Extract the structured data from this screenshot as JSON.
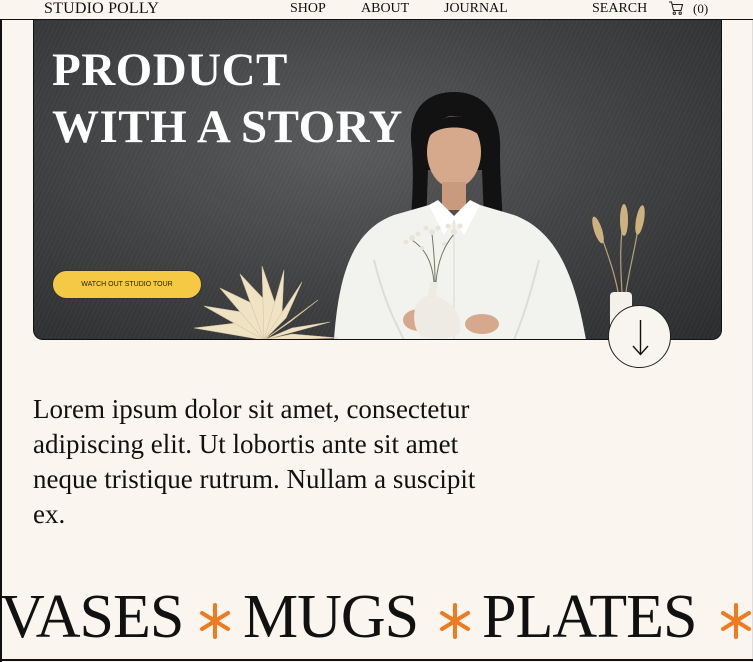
{
  "nav": {
    "logo": "STUDIO POLLY",
    "links": [
      "SHOP",
      "ABOUT",
      "JOURNAL"
    ],
    "search": "SEARCH",
    "cart_icon": "cart-icon",
    "cart_count": "(0)"
  },
  "hero": {
    "headline_line1": "PRODUCT",
    "headline_line2": "WITH A STORY",
    "cta": "WATCH OUT STUDIO TOUR"
  },
  "scroll_button": {
    "icon": "arrow-down-icon"
  },
  "intro": {
    "text": "Lorem ipsum dolor sit amet, consectetur adipiscing elit. Ut lobortis ante sit amet neque tristique rutrum. Nullam a suscipit ex."
  },
  "ticker": {
    "items": [
      "VASES",
      "MUGS",
      "PLATES"
    ],
    "separator_icon": "asterisk-icon"
  },
  "colors": {
    "background": "#faf6ef",
    "accent_yellow": "#f6c945",
    "accent_orange": "#f07a1f",
    "text": "#111111"
  }
}
